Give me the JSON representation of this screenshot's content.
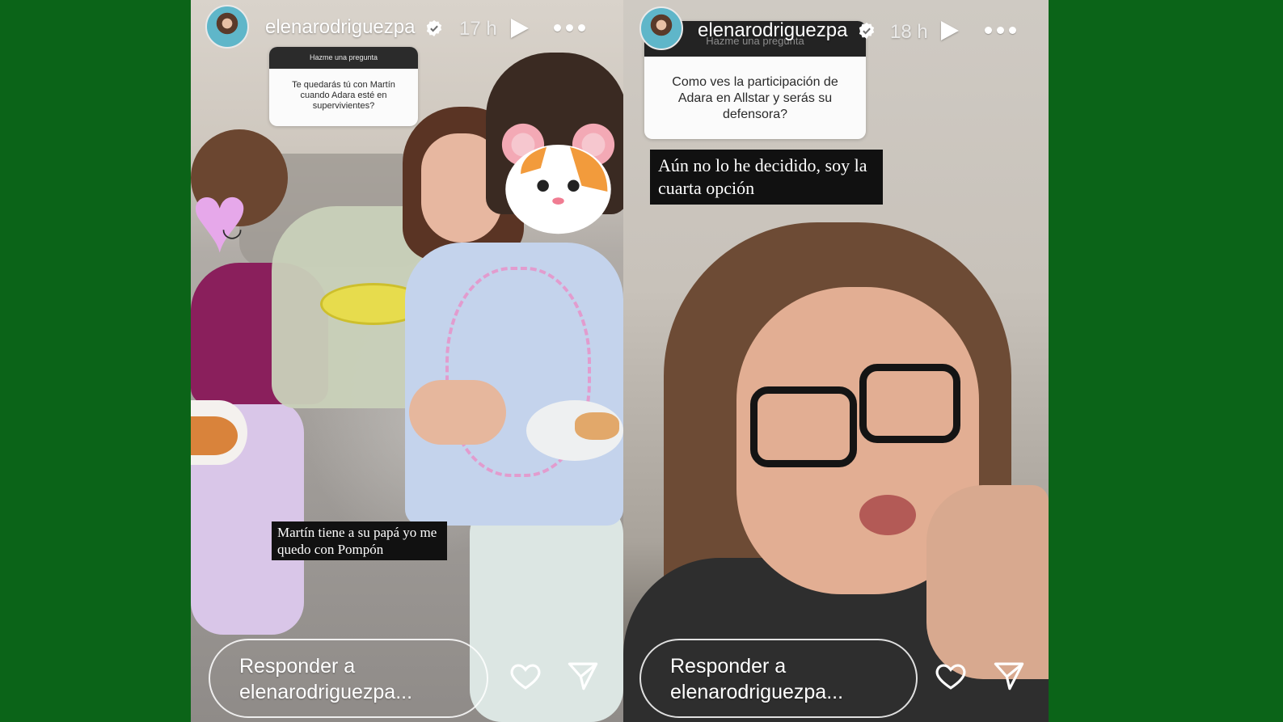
{
  "stories": [
    {
      "username": "elenarodriguezpa",
      "time": "17 h",
      "question_header": "Hazme una pregunta",
      "question_text": "Te quedarás tú con Martín cuando Adara esté en supervivientes?",
      "answer": "Martín tiene a su papá yo me quedo con Pompón",
      "reply_line1": "Responder a",
      "reply_line2": "elenarodriguezpa..."
    },
    {
      "username": "elenarodriguezpa",
      "time": "18 h",
      "question_header": "Hazme una pregunta",
      "question_text": "Como ves la participación de Adara en Allstar y serás su defensora?",
      "answer": "Aún no lo he decidido, soy la cuarta opción",
      "reply_line1": "Responder a",
      "reply_line2": "elenarodriguezpa..."
    }
  ],
  "icons": {
    "verified": "verified-badge-icon",
    "play": "play-icon",
    "more": "more-icon",
    "like": "heart-icon",
    "share": "send-icon"
  },
  "colors": {
    "background": "#0b6418",
    "verified_badge": "#ffffff",
    "caption_bg": "#111111"
  }
}
